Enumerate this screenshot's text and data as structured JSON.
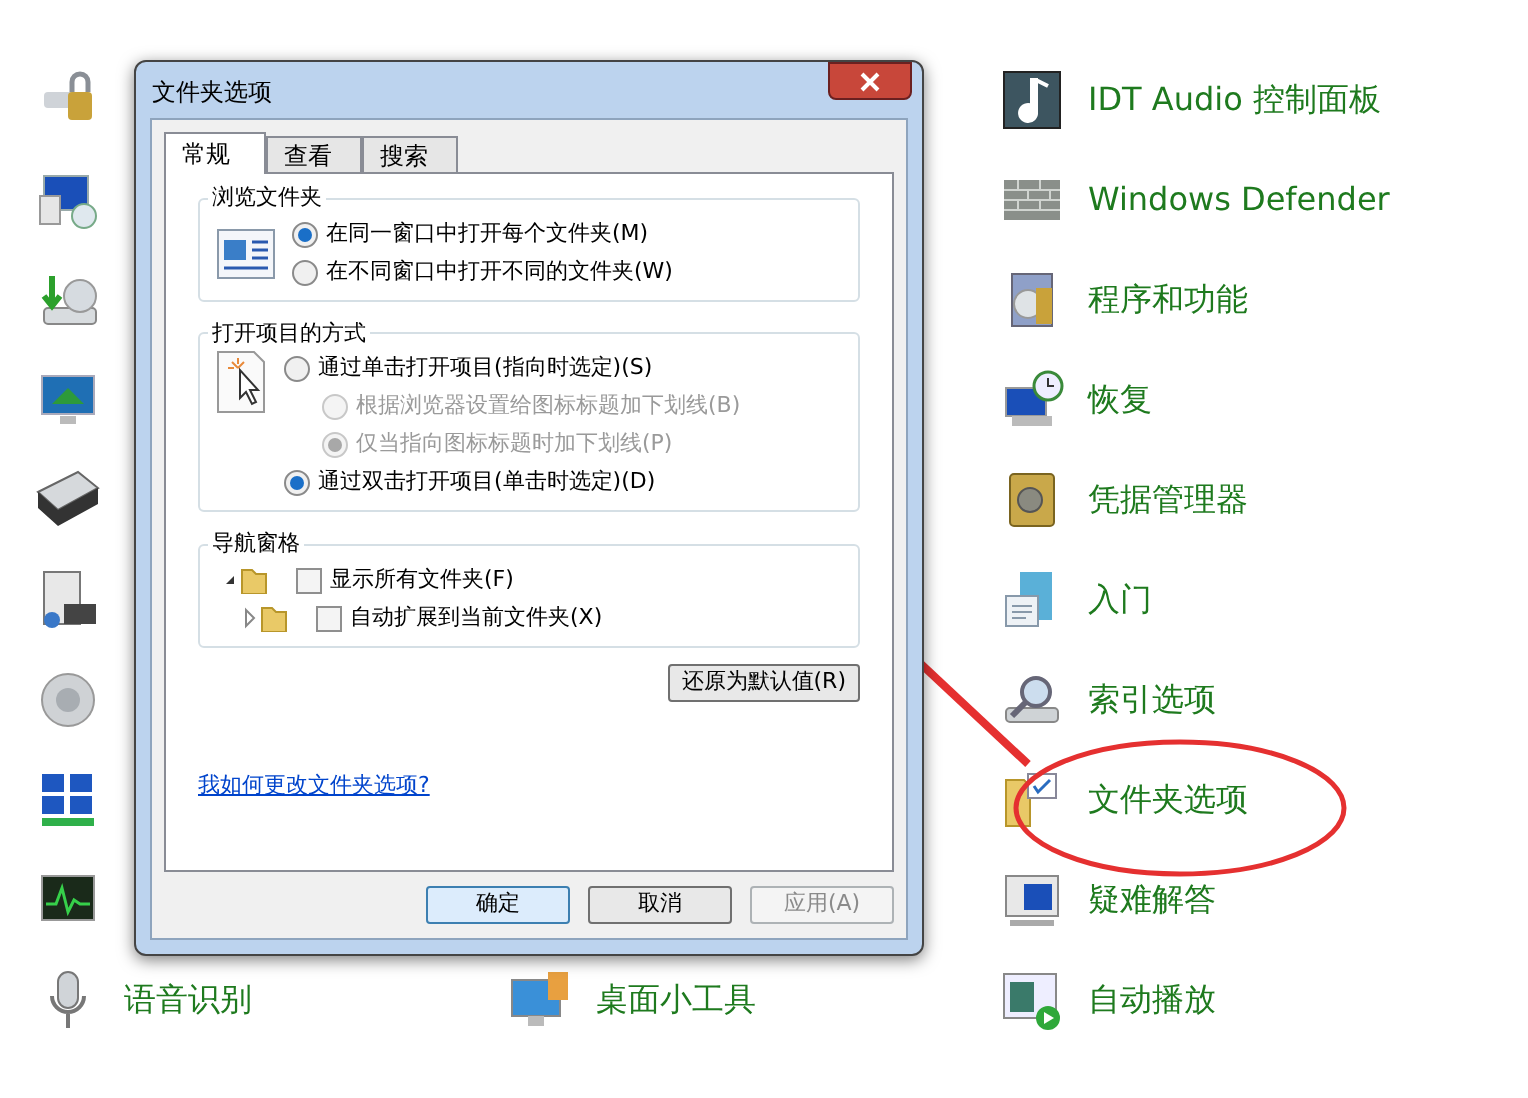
{
  "control_panel": {
    "left_column": [
      {
        "label": "语音识别"
      }
    ],
    "middle_column": [
      {
        "label": "桌面小工具"
      }
    ],
    "right_column": [
      {
        "label": "IDT Audio 控制面板"
      },
      {
        "label": "Windows Defender"
      },
      {
        "label": "程序和功能"
      },
      {
        "label": "恢复"
      },
      {
        "label": "凭据管理器"
      },
      {
        "label": "入门"
      },
      {
        "label": "索引选项"
      },
      {
        "label": "文件夹选项"
      },
      {
        "label": "疑难解答"
      },
      {
        "label": "自动播放"
      }
    ]
  },
  "dialog": {
    "title": "文件夹选项",
    "tabs": [
      {
        "label": "常规",
        "selected": true
      },
      {
        "label": "查看",
        "selected": false
      },
      {
        "label": "搜索",
        "selected": false
      }
    ],
    "browse_folders": {
      "title": "浏览文件夹",
      "options": [
        {
          "label": "在同一窗口中打开每个文件夹(M)",
          "selected": true
        },
        {
          "label": "在不同窗口中打开不同的文件夹(W)",
          "selected": false
        }
      ]
    },
    "click_items": {
      "title": "打开项目的方式",
      "options": [
        {
          "label": "通过单击打开项目(指向时选定)(S)",
          "selected": false,
          "disabled": false,
          "children": [
            {
              "label": "根据浏览器设置给图标标题加下划线(B)",
              "selected": false,
              "disabled": true
            },
            {
              "label": "仅当指向图标标题时加下划线(P)",
              "selected": true,
              "disabled": true
            }
          ]
        },
        {
          "label": "通过双击打开项目(单击时选定)(D)",
          "selected": true,
          "disabled": false
        }
      ]
    },
    "navigation_pane": {
      "title": "导航窗格",
      "options": [
        {
          "label": "显示所有文件夹(F)",
          "checked": false
        },
        {
          "label": "自动扩展到当前文件夹(X)",
          "checked": false
        }
      ]
    },
    "restore_button": "还原为默认值(R)",
    "help_link": "我如何更改文件夹选项?",
    "buttons": [
      {
        "label": "确定",
        "default": true,
        "disabled": false
      },
      {
        "label": "取消",
        "default": false,
        "disabled": false
      },
      {
        "label": "应用(A)",
        "default": false,
        "disabled": true
      }
    ]
  }
}
